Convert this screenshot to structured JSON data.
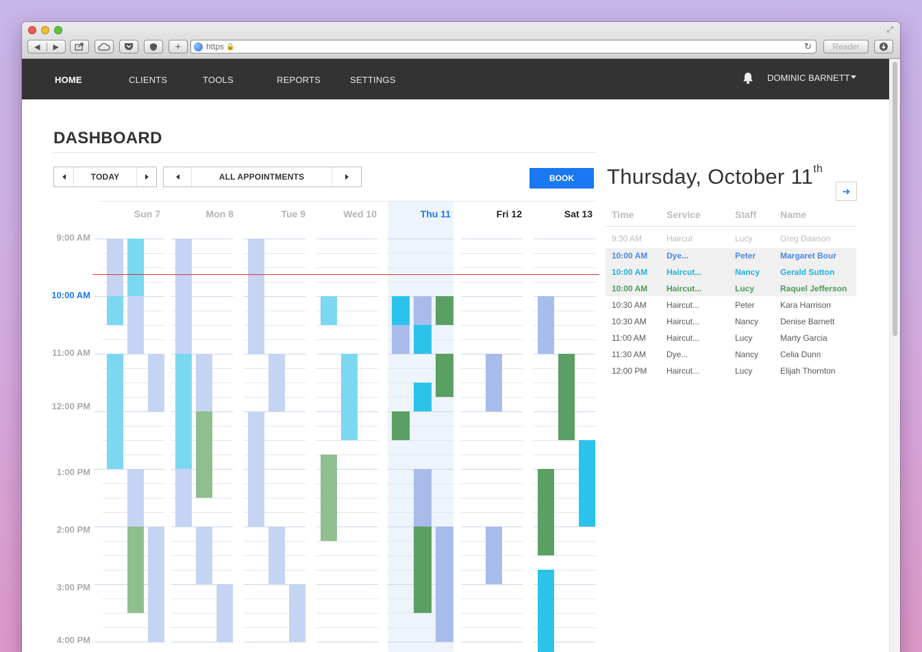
{
  "browser": {
    "url_text": "https",
    "reader_label": "Reader",
    "plus_label": "+"
  },
  "nav": {
    "items": [
      "HOME",
      "CLIENTS",
      "TOOLS",
      "REPORTS",
      "SETTINGS"
    ],
    "active": "HOME",
    "user_name": "DOMINIC BARNETT"
  },
  "page": {
    "title": "DASHBOARD",
    "today_label": "TODAY",
    "filter_label": "ALL APPOINTMENTS",
    "book_label": "BOOK"
  },
  "calendar": {
    "days": [
      "Sun 7",
      "Mon 8",
      "Tue 9",
      "Wed 10",
      "Thu 11",
      "Fri 12",
      "Sat 13"
    ],
    "today": "Thu 11",
    "times": [
      "9:00 AM",
      "10:00 AM",
      "11:00 AM",
      "12:00 PM",
      "1:00 PM",
      "2:00 PM",
      "3:00 PM",
      "4:00 PM"
    ],
    "current_time_label": "10:00 AM",
    "colors": {
      "lavender": "#c5d4f3",
      "periwinkle": "#a8bcec",
      "sky": "#7cd7f1",
      "cyan": "#2bc3ea",
      "sage": "#8fbf8f",
      "green": "#5a9f63",
      "today_band": "#eef4fc",
      "now_line": "#dd3333"
    }
  },
  "agenda": {
    "title": "Thursday, October 11",
    "title_suffix": "th",
    "headers": [
      "Time",
      "Service",
      "Staff",
      "Name"
    ],
    "rows": [
      {
        "time": "9:30   AM",
        "service": "Haircut",
        "staff": "Lucy",
        "name": "Greg Dawson",
        "style": "past"
      },
      {
        "time": "10:00 AM",
        "service": "Dye...",
        "staff": "Peter",
        "name": "Margaret  Bour",
        "style": "blue"
      },
      {
        "time": "10:00 AM",
        "service": "Haircut...",
        "staff": "Nancy",
        "name": "Gerald Sutton",
        "style": "cyan"
      },
      {
        "time": "10:00 AM",
        "service": "Haircut...",
        "staff": "Lucy",
        "name": "Raquel Jefferson",
        "style": "grn"
      },
      {
        "time": "10:30 AM",
        "service": "Haircut...",
        "staff": "Peter",
        "name": "Kara Harrison",
        "style": "normal"
      },
      {
        "time": "10:30 AM",
        "service": "Haircut...",
        "staff": "Nancy",
        "name": "Denise Barnett",
        "style": "normal"
      },
      {
        "time": "11:00 AM",
        "service": "Haircut...",
        "staff": "Lucy",
        "name": "Marty Garcia",
        "style": "normal"
      },
      {
        "time": "11:30 AM",
        "service": "Dye...",
        "staff": "Nancy",
        "name": "Celia Dunn",
        "style": "normal"
      },
      {
        "time": "12:00 PM",
        "service": "Haircut...",
        "staff": "Lucy",
        "name": "Elijah Thornton",
        "style": "normal"
      }
    ]
  }
}
